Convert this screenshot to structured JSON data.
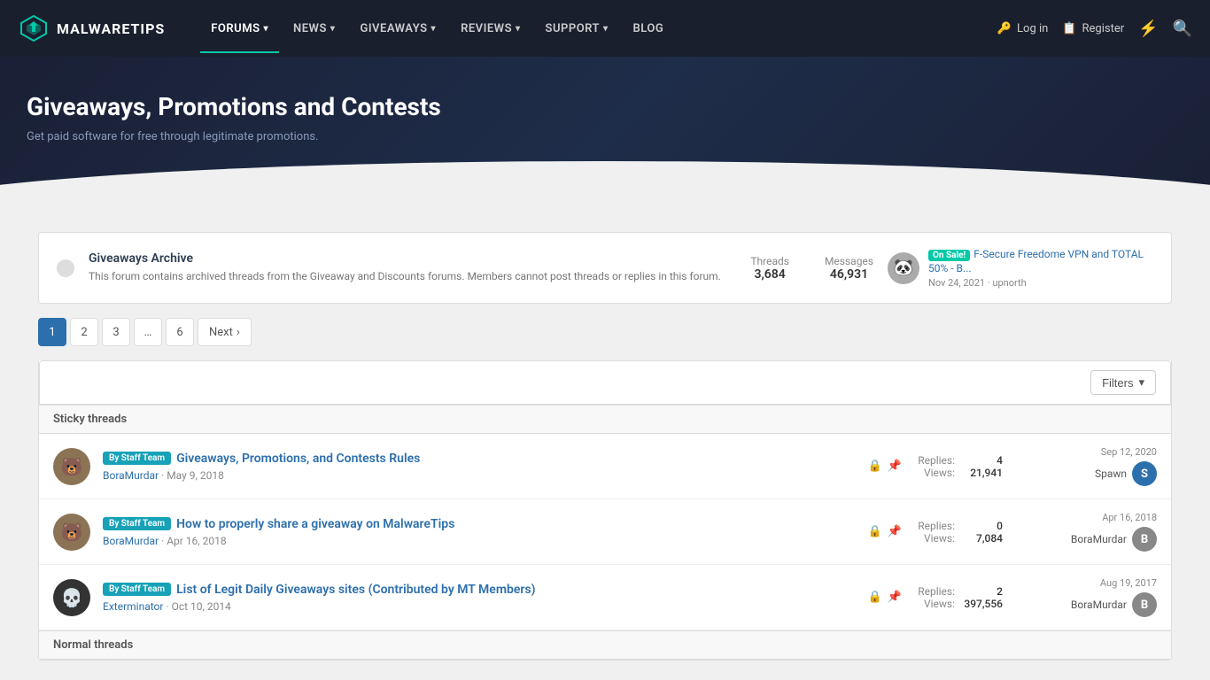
{
  "site": {
    "name": "MALWARETIPS",
    "logo_alt": "MalwareTips logo"
  },
  "nav": {
    "items": [
      {
        "label": "FORUMS",
        "active": false,
        "has_dropdown": true
      },
      {
        "label": "NEWS",
        "active": false,
        "has_dropdown": true
      },
      {
        "label": "GIVEAWAYS",
        "active": true,
        "has_dropdown": true
      },
      {
        "label": "REVIEWS",
        "active": false,
        "has_dropdown": true
      },
      {
        "label": "SUPPORT",
        "active": false,
        "has_dropdown": true
      },
      {
        "label": "BLOG",
        "active": false,
        "has_dropdown": false
      }
    ],
    "login_label": "Log in",
    "register_label": "Register"
  },
  "hero": {
    "title": "Giveaways, Promotions and Contests",
    "subtitle": "Get paid software for free through legitimate promotions."
  },
  "archive": {
    "title": "Giveaways Archive",
    "description": "This forum contains archived threads from the Giveaway and Discounts forums. Members cannot post threads or replies in this forum.",
    "threads_label": "Threads",
    "threads_count": "3,684",
    "messages_label": "Messages",
    "messages_count": "46,931",
    "latest_badge": "On Sale!",
    "latest_title": "F-Secure Freedome VPN and TOTAL 50% - B...",
    "latest_date": "Nov 24, 2021",
    "latest_separator": "·",
    "latest_user": "upnorth"
  },
  "pagination": {
    "pages": [
      "1",
      "2",
      "3",
      "...",
      "6"
    ],
    "next_label": "Next",
    "current": "1"
  },
  "filters": {
    "button_label": "Filters"
  },
  "sticky": {
    "section_label": "Sticky threads",
    "threads": [
      {
        "id": "1",
        "avatar_emoji": "🐻",
        "avatar_class": "bear",
        "tag": "By Staff Team",
        "title": "Giveaways, Promotions, and Contests Rules",
        "author": "BoraMurdar",
        "date": "May 9, 2018",
        "replies_label": "Replies:",
        "replies": "4",
        "views_label": "Views:",
        "views": "21,941",
        "last_date": "Sep 12, 2020",
        "last_user": "Spawn",
        "last_avatar_letter": "S",
        "last_avatar_class": "blue"
      },
      {
        "id": "2",
        "avatar_emoji": "🐻",
        "avatar_class": "bear",
        "tag": "By Staff Team",
        "title": "How to properly share a giveaway on MalwareTips",
        "author": "BoraMurdar",
        "date": "Apr 16, 2018",
        "replies_label": "Replies:",
        "replies": "0",
        "views_label": "Views:",
        "views": "7,084",
        "last_date": "Apr 16, 2018",
        "last_user": "BoraMurdar",
        "last_avatar_letter": "B",
        "last_avatar_class": "gray"
      },
      {
        "id": "3",
        "avatar_emoji": "💀",
        "avatar_class": "skull",
        "tag": "By Staff Team",
        "title": "List of Legit Daily Giveaways sites (Contributed by MT Members)",
        "author": "Exterminator",
        "date": "Oct 10, 2014",
        "replies_label": "Replies:",
        "replies": "2",
        "views_label": "Views:",
        "views": "397,556",
        "last_date": "Aug 19, 2017",
        "last_user": "BoraMurdar",
        "last_avatar_letter": "B",
        "last_avatar_class": "gray"
      }
    ]
  },
  "normal": {
    "section_label": "Normal threads"
  }
}
